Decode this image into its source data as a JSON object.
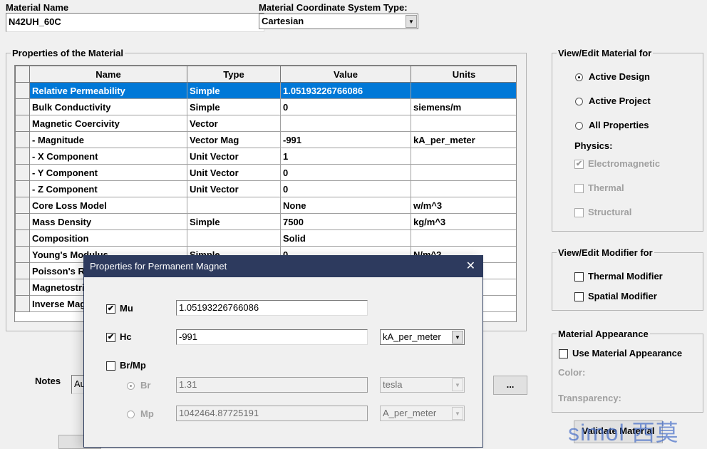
{
  "material_name": {
    "label": "Material Name",
    "value": "N42UH_60C"
  },
  "coord_system": {
    "label": "Material Coordinate System Type:",
    "value": "Cartesian"
  },
  "properties": {
    "legend": "Properties of the Material",
    "columns": [
      "Name",
      "Type",
      "Value",
      "Units"
    ],
    "rows": [
      [
        "Relative Permeability",
        "Simple",
        "1.05193226766086",
        ""
      ],
      [
        "Bulk Conductivity",
        "Simple",
        "0",
        "siemens/m"
      ],
      [
        "Magnetic Coercivity",
        "Vector",
        "",
        ""
      ],
      [
        "-  Magnitude",
        "Vector Mag",
        "-991",
        "kA_per_meter"
      ],
      [
        "-  X Component",
        "Unit Vector",
        "1",
        ""
      ],
      [
        "-  Y Component",
        "Unit Vector",
        "0",
        ""
      ],
      [
        "-  Z Component",
        "Unit Vector",
        "0",
        ""
      ],
      [
        "Core Loss Model",
        "",
        "None",
        "w/m^3"
      ],
      [
        "Mass Density",
        "Simple",
        "7500",
        "kg/m^3"
      ],
      [
        "Composition",
        "",
        "Solid",
        ""
      ],
      [
        "Young's Modulus",
        "Simple",
        "0",
        "N/m^2"
      ],
      [
        "Poisson's Ratio",
        "",
        "",
        ""
      ],
      [
        "Magnetostriction",
        "",
        "",
        ""
      ],
      [
        "Inverse Magnetostriction",
        "",
        "",
        ""
      ]
    ]
  },
  "view_edit": {
    "legend": "View/Edit Material for",
    "options": [
      "Active Design",
      "Active Project",
      "All Properties"
    ],
    "selected": "Active Design",
    "physics_label": "Physics:",
    "physics": [
      {
        "label": "Electromagnetic",
        "checked": true
      },
      {
        "label": "Thermal",
        "checked": false
      },
      {
        "label": "Structural",
        "checked": false
      }
    ]
  },
  "modifier": {
    "legend": "View/Edit Modifier for",
    "options": [
      "Thermal Modifier",
      "Spatial Modifier"
    ]
  },
  "appearance": {
    "legend": "Material Appearance",
    "use_label": "Use Material Appearance",
    "color_label": "Color:",
    "transparency_label": "Transparency:"
  },
  "notes": {
    "label": "Notes",
    "value": "Au"
  },
  "ellipsis_button": "...",
  "validate_button": "Validate Material",
  "watermark": "simol 西莫",
  "dialog": {
    "title": "Properties for Permanent Magnet",
    "mu": {
      "label": "Mu",
      "checked": true,
      "value": "1.05193226766086"
    },
    "hc": {
      "label": "Hc",
      "checked": true,
      "value": "-991",
      "unit": "kA_per_meter"
    },
    "brmp": {
      "label": "Br/Mp",
      "checked": false
    },
    "br": {
      "label": "Br",
      "selected": true,
      "value": "1.31",
      "unit": "tesla"
    },
    "mp": {
      "label": "Mp",
      "selected": false,
      "value": "1042464.87725191",
      "unit": "A_per_meter"
    }
  }
}
